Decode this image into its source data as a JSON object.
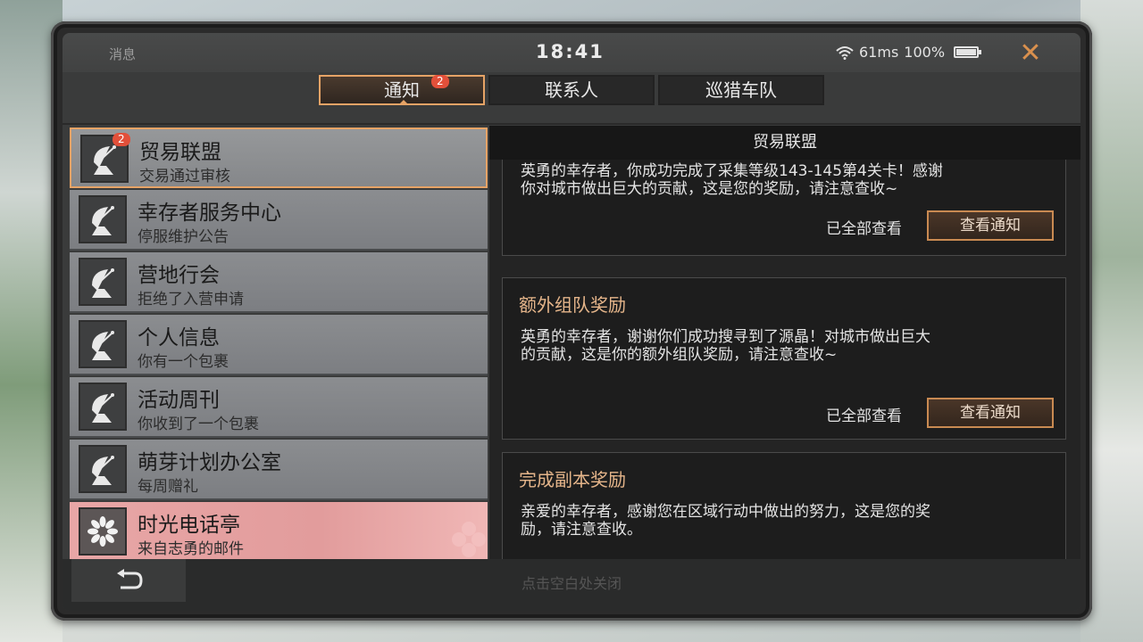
{
  "status_bar": {
    "app_title": "消息",
    "time": "18:41",
    "ping": "61ms",
    "battery": "100%",
    "battery_level": 1.0
  },
  "tabs": [
    {
      "label": "通知",
      "badge": "2",
      "active": true
    },
    {
      "label": "联系人"
    },
    {
      "label": "巡猎车队"
    }
  ],
  "list": {
    "items": [
      {
        "name": "贸易联盟",
        "subtitle": "交易通过审核",
        "badge": "2",
        "selected": true
      },
      {
        "name": "幸存者服务中心",
        "subtitle": "停服维护公告"
      },
      {
        "name": "营地行会",
        "subtitle": "拒绝了入营申请"
      },
      {
        "name": "个人信息",
        "subtitle": "你有一个包裹"
      },
      {
        "name": "活动周刊",
        "subtitle": "你收到了一个包裹"
      },
      {
        "name": "萌芽计划办公室",
        "subtitle": "每周赠礼"
      },
      {
        "name": "时光电话亭",
        "subtitle": "来自志勇的邮件"
      }
    ]
  },
  "panel": {
    "title": "贸易联盟",
    "cards": [
      {
        "title": "",
        "body_line1": "英勇的幸存者，你成功完成了采集等级143-145第4关卡！感谢",
        "body_line2": "你对城市做出巨大的贡献，这是您的奖励，请注意查收~",
        "read_label": "已全部查看",
        "button": "查看通知"
      },
      {
        "title": "额外组队奖励",
        "body_line1": "英勇的幸存者，谢谢你们成功搜寻到了源晶！对城市做出巨大",
        "body_line2": "的贡献，这是你的额外组队奖励，请注意查收~",
        "read_label": "已全部查看",
        "button": "查看通知"
      },
      {
        "title": "完成副本奖励",
        "body_line1": "亲爱的幸存者，感谢您在区域行动中做出的努力，这是您的奖",
        "body_line2": "励，请注意查收。"
      }
    ]
  },
  "footer": {
    "hint": "点击空白处关闭"
  },
  "colors": {
    "accent": "#e6a366",
    "badge": "#e2503a",
    "card_title": "#e5b58a"
  }
}
